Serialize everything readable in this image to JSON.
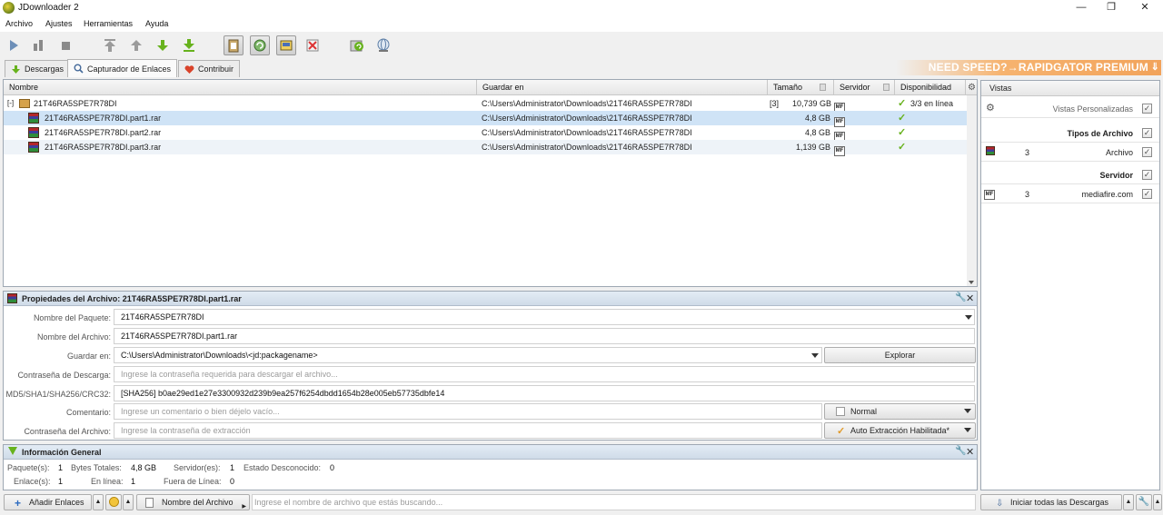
{
  "window": {
    "title": "JDownloader 2",
    "minimize": "—",
    "maximize": "❐",
    "close": "✕"
  },
  "menu": [
    "Archivo",
    "Ajustes",
    "Herramientas",
    "Ayuda"
  ],
  "tabs": [
    {
      "label": "Descargas",
      "icon": "download-arrow-icon"
    },
    {
      "label": "Capturador de Enlaces",
      "icon": "linkgrabber-icon"
    },
    {
      "label": "Contribuir",
      "icon": "heart-icon"
    }
  ],
  "promo": "NEED SPEED?→RAPIDGATOR PREMIUM",
  "table": {
    "headers": [
      "Nombre",
      "Guardar en",
      "Tamaño",
      "Servidor",
      "Disponibilidad"
    ],
    "package": {
      "name": "21T46RA5SPE7R78DI",
      "path": "C:\\Users\\Administrator\\Downloads\\21T46RA5SPE7R78DI",
      "count": "[3]",
      "size": "10,739 GB",
      "host": "MF",
      "availability": "3/3 en línea",
      "toggle": "[-]"
    },
    "files": [
      {
        "name": "21T46RA5SPE7R78DI.part1.rar",
        "path": "C:\\Users\\Administrator\\Downloads\\21T46RA5SPE7R78DI",
        "size": "4,8 GB",
        "host": "MF",
        "check": "✓"
      },
      {
        "name": "21T46RA5SPE7R78DI.part2.rar",
        "path": "C:\\Users\\Administrator\\Downloads\\21T46RA5SPE7R78DI",
        "size": "4,8 GB",
        "host": "MF",
        "check": "✓"
      },
      {
        "name": "21T46RA5SPE7R78DI.part3.rar",
        "path": "C:\\Users\\Administrator\\Downloads\\21T46RA5SPE7R78DI",
        "size": "1,139 GB",
        "host": "MF",
        "check": "✓"
      }
    ]
  },
  "vistas": {
    "title": "Vistas",
    "custom_label": "Vistas Personalizadas",
    "types_header": "Tipos de Archivo",
    "type_row": {
      "count": "3",
      "label": "Archivo"
    },
    "server_header": "Servidor",
    "server_row": {
      "count": "3",
      "label": "mediafire.com",
      "icon": "MF"
    },
    "check": "✓"
  },
  "props": {
    "title": "Propiedades del Archivo: 21T46RA5SPE7R78DI.part1.rar",
    "labels": {
      "package": "Nombre del Paquete:",
      "file": "Nombre del Archivo:",
      "save": "Guardar en:",
      "dlpass": "Contraseña de Descarga:",
      "hash": "MD5/SHA1/SHA256/CRC32:",
      "comment": "Comentario:",
      "archpass": "Contraseña del Archivo:"
    },
    "values": {
      "package": "21T46RA5SPE7R78DI",
      "file": "21T46RA5SPE7R78DI.part1.rar",
      "save": "C:\\Users\\Administrator\\Downloads\\<jd:packagename>",
      "hash": "[SHA256] b0ae29ed1e27e3300932d239b9ea257f6254dbdd1654b28e005eb57735dbfe14"
    },
    "placeholders": {
      "dlpass": "Ingrese la contraseña requerida para descargar el archivo...",
      "comment": "Ingrese un comentario o bien déjelo vacío...",
      "archpass": "Ingrese la contraseña de extracción"
    },
    "buttons": {
      "browse": "Explorar",
      "priority": "Normal",
      "extract": "Auto Extracción Habilitada*"
    }
  },
  "info": {
    "title": "Información General",
    "packages_label": "Paquete(s):",
    "packages": "1",
    "bytes_label": "Bytes Totales:",
    "bytes": "4,8 GB",
    "servers_label": "Servidor(es):",
    "servers": "1",
    "unknown_label": "Estado Desconocido:",
    "unknown": "0",
    "links_label": "Enlace(s):",
    "links": "1",
    "online_label": "En línea:",
    "online": "1",
    "offline_label": "Fuera de Línea:",
    "offline": "0"
  },
  "bottom": {
    "add_links": "Añadir Enlaces",
    "filter_mode": "Nombre del Archivo",
    "search_placeholder": "Ingrese el nombre de archivo que estás buscando...",
    "start_all": "Iniciar todas las Descargas"
  }
}
